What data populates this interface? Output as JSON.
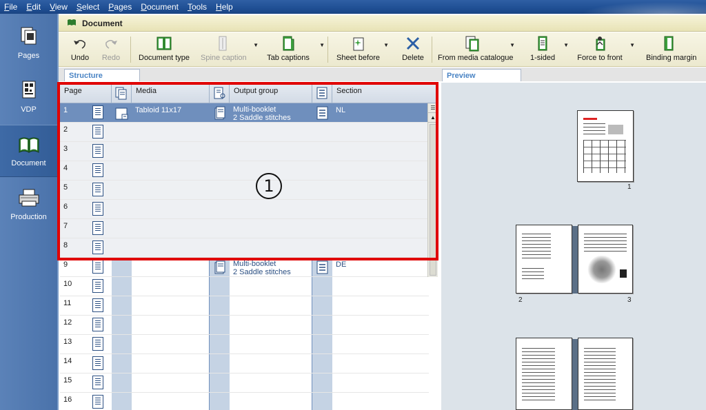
{
  "menu": [
    "File",
    "Edit",
    "View",
    "Select",
    "Pages",
    "Document",
    "Tools",
    "Help"
  ],
  "nav": [
    {
      "label": "Pages",
      "icon": "pages-icon"
    },
    {
      "label": "VDP",
      "icon": "vdp-icon"
    },
    {
      "label": "Document",
      "icon": "book-icon",
      "active": true
    },
    {
      "label": "Production",
      "icon": "printer-icon"
    }
  ],
  "header": {
    "title": "Document"
  },
  "toolbar": {
    "undo": "Undo",
    "redo": "Redo",
    "document_type": "Document type",
    "spine_caption": "Spine caption",
    "tab_captions": "Tab captions",
    "sheet_before": "Sheet before",
    "delete": "Delete",
    "from_media_catalogue": "From media catalogue",
    "one_sided": "1-sided",
    "force_to_front": "Force to front",
    "binding_margin": "Binding margin"
  },
  "tabs": {
    "structure": "Structure",
    "preview": "Preview"
  },
  "columns": {
    "page": "Page",
    "media": "Media",
    "output_group": "Output group",
    "section": "Section"
  },
  "rows": [
    {
      "page": "1",
      "media": "Tabloid 11x17",
      "output_group_1": "Multi-booklet",
      "output_group_2": "2 Saddle stitches",
      "section": "NL"
    },
    {
      "page": "2"
    },
    {
      "page": "3"
    },
    {
      "page": "4"
    },
    {
      "page": "5"
    },
    {
      "page": "6"
    },
    {
      "page": "7"
    },
    {
      "page": "8"
    },
    {
      "page": "9",
      "output_group_1": "Multi-booklet",
      "output_group_2": "2 Saddle stitches",
      "section": "DE"
    },
    {
      "page": "10"
    },
    {
      "page": "11"
    },
    {
      "page": "12"
    },
    {
      "page": "13"
    },
    {
      "page": "14"
    },
    {
      "page": "15"
    },
    {
      "page": "16"
    }
  ],
  "callout": "1",
  "preview_pages": [
    "1",
    "2",
    "3"
  ],
  "colors": {
    "highlight": "#e00000",
    "selected_row": "#6f8fbd",
    "menubar": "#1f4f94"
  }
}
